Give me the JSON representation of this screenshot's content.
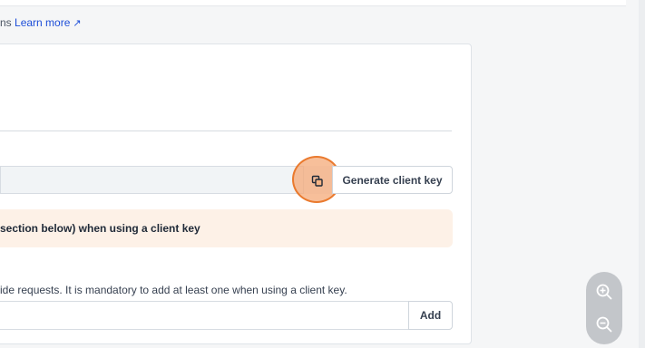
{
  "header": {
    "learn_prefix": "ns",
    "learn_more_label": "Learn more",
    "external_glyph": "↗"
  },
  "client_key": {
    "value": "",
    "copy_icon": "copy-icon",
    "generate_label": "Generate client key"
  },
  "warning": {
    "text": "section below) when using a client key"
  },
  "domains": {
    "help_text": "ide requests. It is mandatory to add at least one when using a client key.",
    "input_value": "",
    "add_label": "Add"
  },
  "zoom": {
    "in_icon": "zoom-in-icon",
    "out_icon": "zoom-out-icon"
  },
  "colors": {
    "focus_accent": "#ea7a2e",
    "warning_bg": "#fdf1e7",
    "link": "#1d4ed8"
  }
}
